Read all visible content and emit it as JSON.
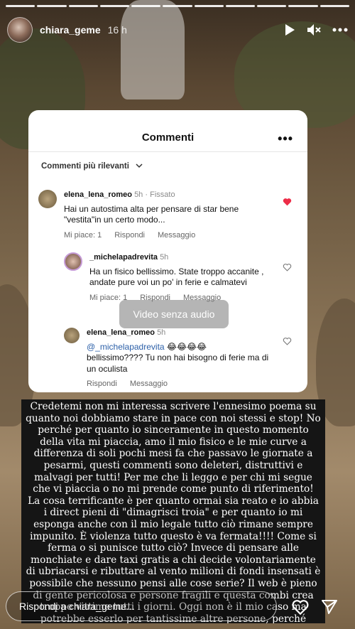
{
  "story": {
    "username": "chiara_geme",
    "time": "16 h",
    "progress_segments": 11,
    "icons": [
      "play-icon",
      "mute-icon",
      "more-icon"
    ]
  },
  "card": {
    "title": "Commenti",
    "more": "•••",
    "sort_label": "Commenti più rilevanti",
    "comments": [
      {
        "user": "elena_lena_romeo",
        "time": "5h",
        "tag": "Fissato",
        "text": "Hai un autostima alta per pensare di star bene \"vestita\"in un certo modo...",
        "like": "Mi piace: 1",
        "reply": "Rispondi",
        "message": "Messaggio",
        "liked": true
      },
      {
        "user": "_michelapadrevita",
        "time": "5h",
        "text": "Ha un fisico bellissimo. State troppo accanite , andate pure voi un po' in ferie e calmatevi",
        "like": "Mi piace: 1",
        "reply": "Rispondi",
        "message": "Messaggio"
      },
      {
        "user": "elena_lena_romeo",
        "time": "5h",
        "mention": "@_michelapadrevita",
        "emoji": "😂😂😂😂",
        "text": "bellissimo???? Tu non hai bisogno di ferie ma di un oculista",
        "reply": "Rispondi",
        "message": "Messaggio"
      }
    ],
    "overlay": "Video senza audio"
  },
  "caption": "Credetemi non mi interessa scrivere l'ennesimo poema su quanto noi dobbiamo stare in pace con noi stessi e stop! No perché per quanto io sinceramente in questo momento della vita mi piaccia, amo il mio fisico e le mie curve a differenza di soli pochi mesi fa che passavo le giornate a pesarmi, questi commenti sono deleteri, distruttivi e malvagi per tutti! Per me che li leggo e per chi mi segue che vi piaccia o no mi prende come punto di riferimento! La cosa terrificante è per quanto ormai sia reato e io abbia i direct pieni di \"dimagrisci troia\" e per quanto io mi esponga anche con il mio legale tutto ciò rimane sempre impunito. È violenza tutto questo è va fermata!!!! Come si ferma o si punisce tutto ciò? Invece di pensare alle monchiate e dare taxi gratis a chi decide volontariamente di ubriacarsi e ributtare al vento milioni di fondi insensati è possibile che nessuno pensi alle cose serie? Il web è pieno di gente pericolosa e persone fragili e questa combi crea troppe vittime tutti i giorni. Oggi non è il mio caso ma potrebbe esserlo per tantissime altre persone, perché arrivare a piangere lo morto prima di agire?",
  "reply_bar": {
    "placeholder": "Rispondi a chiara_geme..."
  }
}
